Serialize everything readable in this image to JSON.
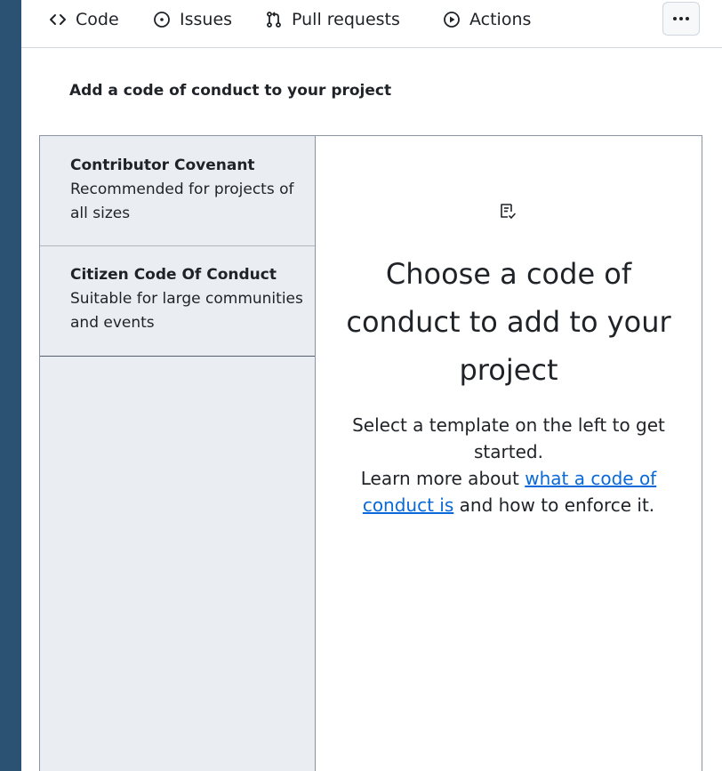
{
  "nav": {
    "items": [
      {
        "label": "Code",
        "icon": "code-icon"
      },
      {
        "label": "Issues",
        "icon": "issue-opened-icon"
      },
      {
        "label": "Pull requests",
        "icon": "git-pull-request-icon"
      },
      {
        "label": "Actions",
        "icon": "play-icon"
      }
    ],
    "more_icon": "kebab-horizontal-icon"
  },
  "section": {
    "title": "Add a code of conduct to your project"
  },
  "templates": [
    {
      "name": "Contributor Covenant",
      "description": "Recommended for projects of all sizes"
    },
    {
      "name": "Citizen Code Of Conduct",
      "description": "Suitable for large communities and events"
    }
  ],
  "main": {
    "icon": "checklist-icon",
    "heading": "Choose a code of conduct to add to your project",
    "text_intro": "Select a template on the left to get started.",
    "text_learn_prefix": "Learn more about",
    "link_text": "what a code of conduct is",
    "text_learn_suffix": "and how to enforce it."
  },
  "colors": {
    "backdrop": "#2c5273",
    "sidebar_bg": "#eaeef2",
    "link": "#0969da",
    "text": "#1f2328"
  }
}
